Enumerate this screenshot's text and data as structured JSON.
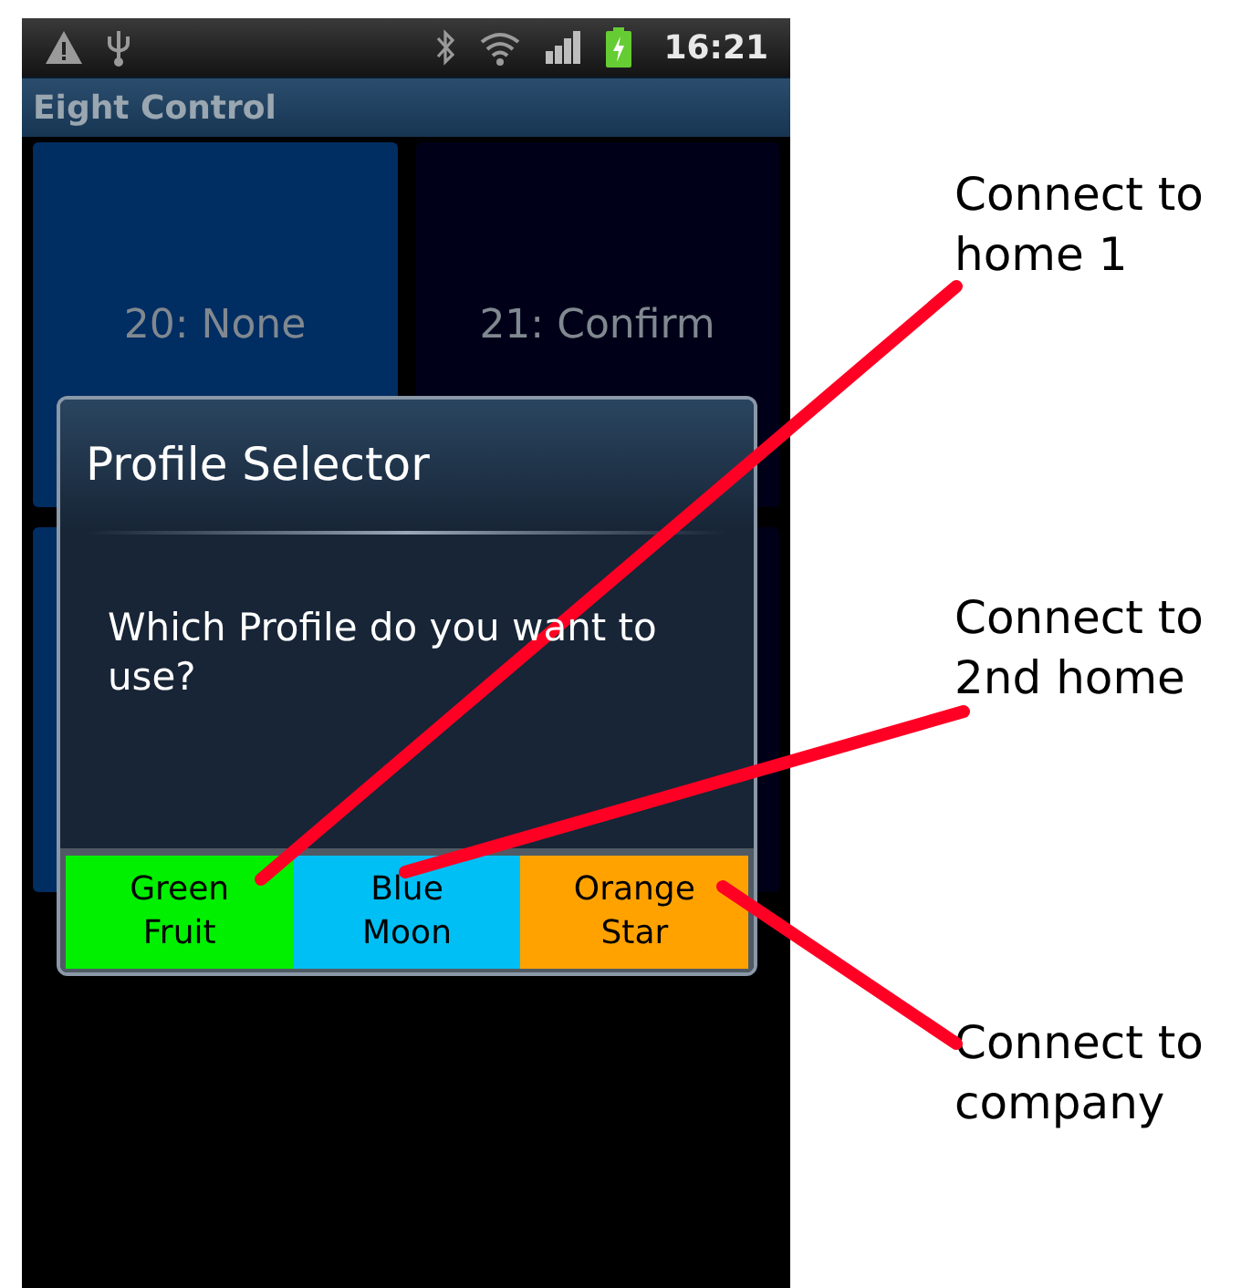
{
  "status_bar": {
    "time": "16:21"
  },
  "app_bar": {
    "title": "Eight Control"
  },
  "tiles": [
    {
      "label": "20: None",
      "color": "#002d62"
    },
    {
      "label": "21: Confirm",
      "color": "#000018"
    },
    {
      "color": "#002d62"
    },
    {
      "color": "#000018"
    }
  ],
  "dialog": {
    "title": "Profile Selector",
    "message": "Which Profile do you want to use?",
    "buttons": [
      {
        "label": "Green Fruit",
        "color": "#00f000"
      },
      {
        "label": "Blue Moon",
        "color": "#00bff5"
      },
      {
        "label": "Orange Star",
        "color": "#ffa200"
      }
    ]
  },
  "annotations": [
    {
      "text": "Connect to home 1"
    },
    {
      "text": "Connect to 2nd home"
    },
    {
      "text": "Connect to company"
    }
  ]
}
